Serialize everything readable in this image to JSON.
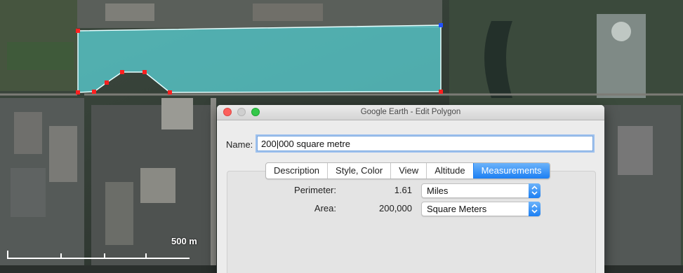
{
  "map": {
    "scale_label": "500 m",
    "polygon_fill": "#5bd8dc",
    "vertex_color": "#ff2020",
    "active_vertex_color": "#2050ff"
  },
  "window": {
    "title": "Google Earth - Edit Polygon"
  },
  "form": {
    "name_label": "Name:",
    "name_value": "200|000 square metre"
  },
  "tabs": [
    {
      "label": "Description",
      "active": false
    },
    {
      "label": "Style, Color",
      "active": false
    },
    {
      "label": "View",
      "active": false
    },
    {
      "label": "Altitude",
      "active": false
    },
    {
      "label": "Measurements",
      "active": true
    }
  ],
  "measurements": {
    "perimeter": {
      "label": "Perimeter:",
      "value": "1.61",
      "unit": "Miles"
    },
    "area": {
      "label": "Area:",
      "value": "200,000",
      "unit": "Square Meters"
    }
  },
  "colors": {
    "accent": "#1c7ff3",
    "close_light": "#fc605c",
    "max_light": "#34c84a"
  }
}
